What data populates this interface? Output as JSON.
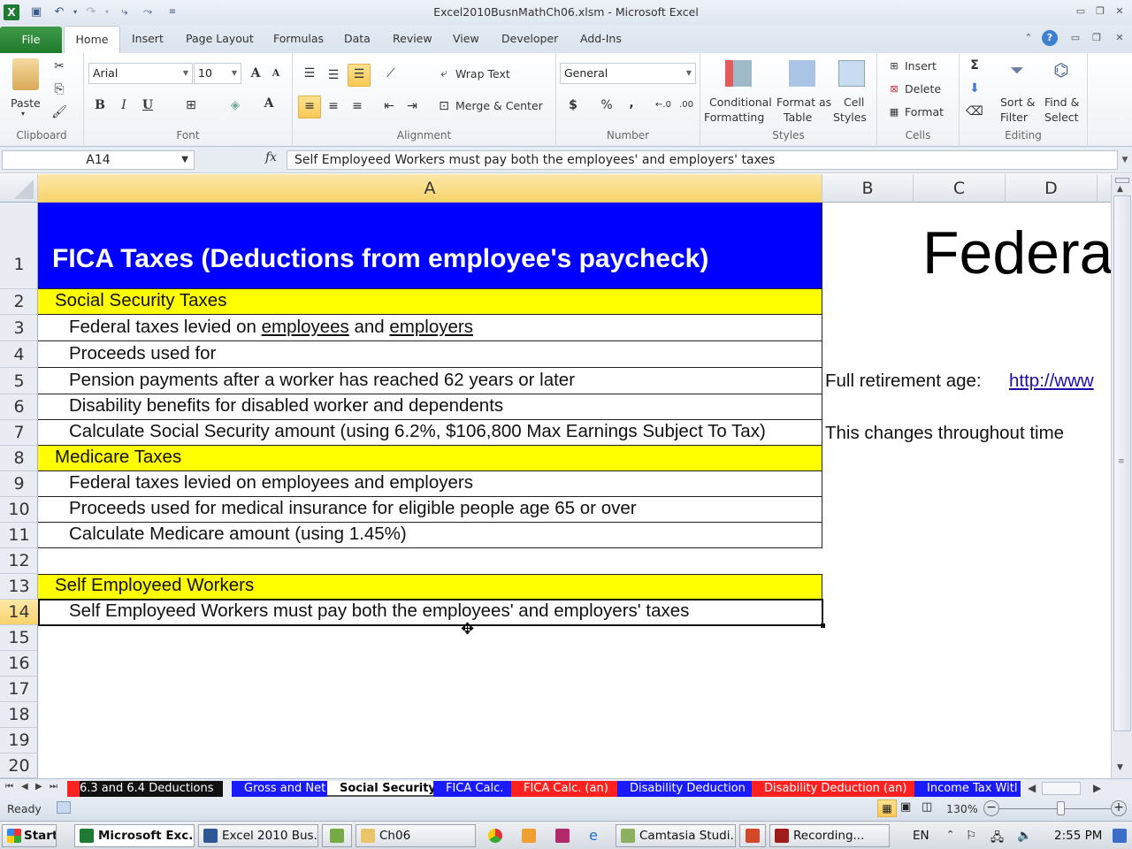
{
  "window": {
    "title": "Excel2010BusnMathCh06.xlsm  -  Microsoft Excel"
  },
  "ribbon_tabs": [
    "File",
    "Home",
    "Insert",
    "Page Layout",
    "Formulas",
    "Data",
    "Review",
    "View",
    "Developer",
    "Add-Ins"
  ],
  "active_tab": "Home",
  "ribbon": {
    "clipboard": {
      "paste": "Paste",
      "label": "Clipboard"
    },
    "font": {
      "name": "Arial",
      "size": "10",
      "label": "Font",
      "bold": "B",
      "italic": "I",
      "underline": "U"
    },
    "alignment": {
      "wrap_text": "Wrap Text",
      "merge_center": "Merge & Center",
      "label": "Alignment"
    },
    "number": {
      "format": "General",
      "currency": "$",
      "percent": "%",
      "comma": ",",
      "label": "Number"
    },
    "styles": {
      "conditional_1": "Conditional",
      "conditional_2": "Formatting",
      "format_table_1": "Format as",
      "format_table_2": "Table",
      "cell_styles_1": "Cell",
      "cell_styles_2": "Styles",
      "label": "Styles"
    },
    "cells": {
      "insert": "Insert",
      "delete": "Delete",
      "format": "Format",
      "label": "Cells"
    },
    "editing": {
      "sort_1": "Sort &",
      "sort_2": "Filter",
      "find_1": "Find &",
      "find_2": "Select",
      "label": "Editing"
    }
  },
  "formula_bar": {
    "name_box": "A14",
    "fx": "fx",
    "content": "Self Employeed Workers must pay both the employees' and employers' taxes"
  },
  "columns": [
    "A",
    "B",
    "C",
    "D"
  ],
  "selected_column": "A",
  "rows": [
    "1",
    "2",
    "3",
    "4",
    "5",
    "6",
    "7",
    "8",
    "9",
    "10",
    "11",
    "12",
    "13",
    "14",
    "15",
    "16",
    "17",
    "18",
    "19",
    "20"
  ],
  "selected_row": "14",
  "cells": {
    "A1": "FICA Taxes (Deductions from employee's paycheck)",
    "A2": "Social Security Taxes",
    "A3_pre": "Federal taxes levied on ",
    "A3_u1": "employees",
    "A3_mid": " and ",
    "A3_u2": "employers",
    "A4": "Proceeds used for",
    "A5": "Pension payments after a worker has reached 62 years or later",
    "A6": "Disability benefits for disabled worker and dependents",
    "A7": "Calculate Social Security amount (using 6.2%, $106,800 Max Earnings Subject To Tax)",
    "A8": "Medicare Taxes",
    "A9": "Federal taxes levied on employees and employers",
    "A10": "Proceeds used for medical insurance for eligible people age 65 or over",
    "A11": "Calculate Medicare amount (using 1.45%)",
    "A13": "Self Employeed Workers",
    "A14": "Self Employeed Workers must pay both the employees' and employers' taxes",
    "C1": "Federa",
    "B5": "Full retirement age:",
    "C5_link": "http://www",
    "B7": "This changes throughout time"
  },
  "colors": {
    "header_blue": "#0000ff",
    "section_yellow": "#ffff00",
    "link": "#1a0dab"
  },
  "sheet_tabs": [
    {
      "label": "6.3 and 6.4 Deductions",
      "color": "#111111"
    },
    {
      "label": "Gross and Net",
      "color": "#1a1aff"
    },
    {
      "label": "Social Security",
      "color": "active"
    },
    {
      "label": "FICA Calc.",
      "color": "#1a1aff"
    },
    {
      "label": "FICA Calc. (an)",
      "color": "#ff2020"
    },
    {
      "label": "Disability Deduction",
      "color": "#1a1aff"
    },
    {
      "label": "Disability Deduction (an)",
      "color": "#ff2020"
    },
    {
      "label": "Income Tax Witl",
      "color": "#1a1aff"
    }
  ],
  "status_bar": {
    "mode": "Ready",
    "zoom": "130%",
    "zoom_level_percent": 130
  },
  "taskbar": {
    "start": "Start",
    "items": [
      "Microsoft Exc...",
      "Excel 2010 Bus...",
      "Ch06",
      "Camtasia Studi...",
      "Recording..."
    ],
    "lang": "EN",
    "time": "2:55 PM"
  }
}
